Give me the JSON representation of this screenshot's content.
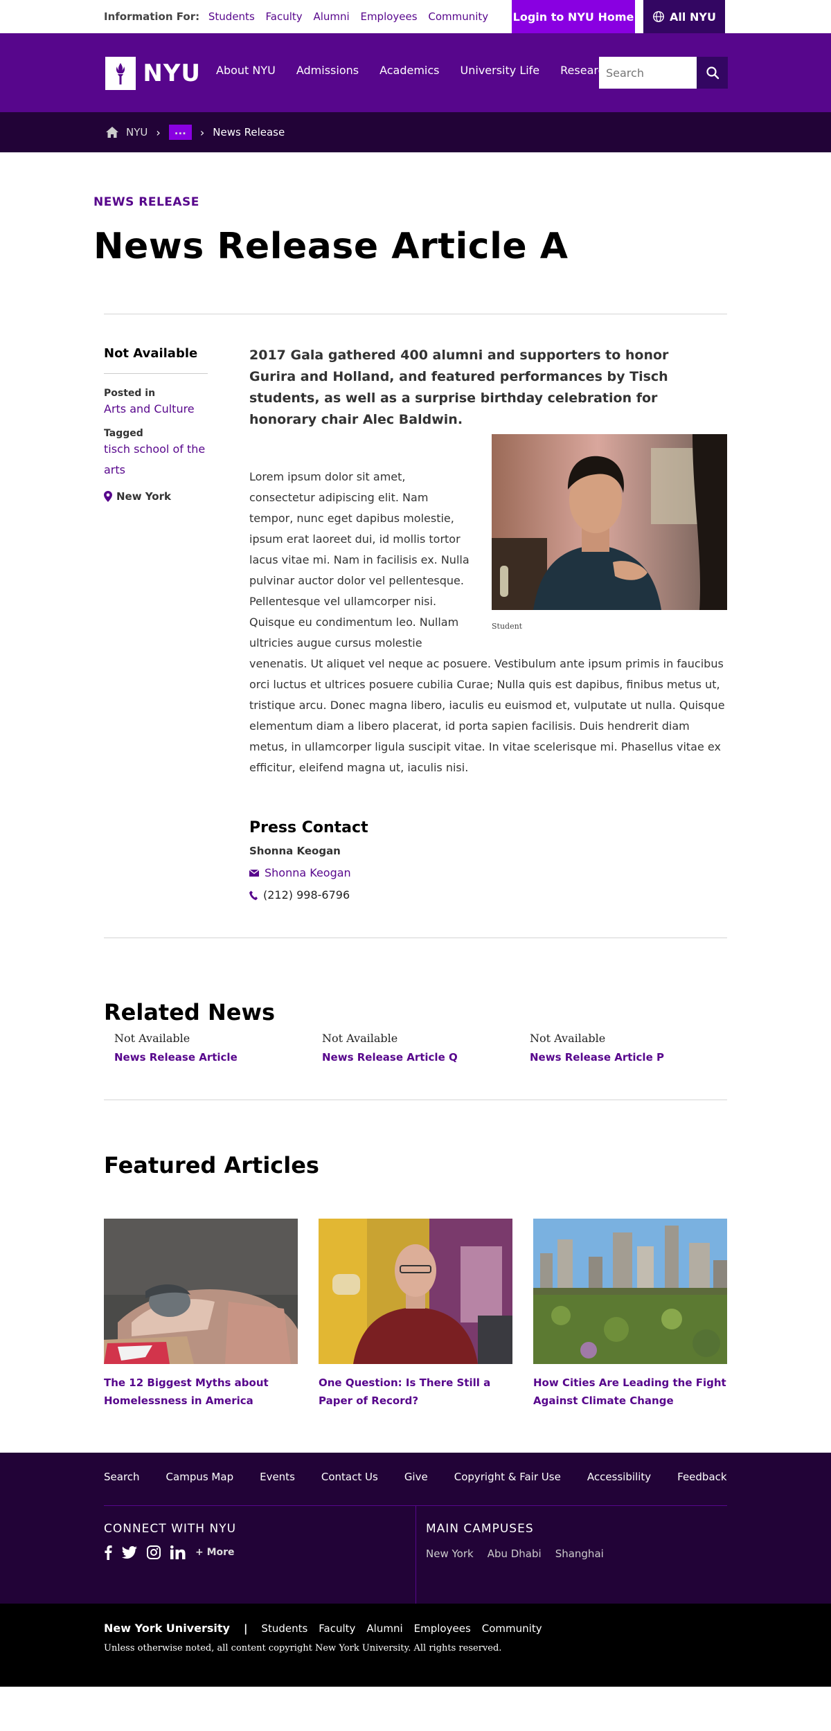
{
  "utility": {
    "info_label": "Information For:",
    "audiences": [
      "Students",
      "Faculty",
      "Alumni",
      "Employees",
      "Community"
    ],
    "login_label": "Login to NYU Home",
    "all_nyu_label": "All NYU"
  },
  "header": {
    "logo_text": "NYU",
    "nav": [
      "About NYU",
      "Admissions",
      "Academics",
      "University Life",
      "Research"
    ],
    "search_placeholder": "Search"
  },
  "breadcrumb": {
    "home": "NYU",
    "ellipsis": "...",
    "current": "News Release"
  },
  "article": {
    "kicker": "NEWS RELEASE",
    "title": "News Release Article A",
    "lead": "2017 Gala gathered 400 alumni and supporters to honor Gurira and Holland, and featured performances by Tisch students, as well as a surprise birthday celebration for honorary chair Alec Baldwin.",
    "image_caption": "Student",
    "body": "Lorem ipsum dolor sit amet, consectetur adipiscing elit. Nam tempor, nunc eget dapibus molestie, ipsum erat laoreet dui, id mollis tortor lacus vitae mi. Nam in facilisis ex. Nulla pulvinar auctor dolor vel pellentesque. Pellentesque vel ullamcorper nisi. Quisque eu condimentum leo. Nullam ultricies augue cursus molestie venenatis. Ut aliquet vel neque ac posuere. Vestibulum ante ipsum primis in faucibus orci luctus et ultrices posuere cubilia Curae; Nulla quis est dapibus, finibus metus ut, tristique arcu. Donec magna libero, iaculis eu euismod et, vulputate ut nulla. Quisque elementum diam a libero placerat, id porta sapien facilisis. Duis hendrerit diam metus, in ullamcorper ligula suscipit vitae. In vitae scelerisque mi. Phasellus vitae ex efficitur, eleifend magna ut, iaculis nisi."
  },
  "sidebar": {
    "status": "Not Available",
    "posted_label": "Posted in",
    "posted_value": "Arts and Culture",
    "tagged_label": "Tagged",
    "tagged_value": "tisch school of the arts",
    "location": "New York"
  },
  "press": {
    "heading": "Press Contact",
    "name": "Shonna Keogan",
    "email_link": "Shonna Keogan",
    "phone": "(212) 998-6796"
  },
  "related": {
    "heading": "Related News",
    "items": [
      {
        "status": "Not Available",
        "title": "News Release Article"
      },
      {
        "status": "Not Available",
        "title": "News Release Article Q"
      },
      {
        "status": "Not Available",
        "title": "News Release Article P"
      }
    ]
  },
  "featured": {
    "heading": "Featured Articles",
    "items": [
      {
        "title": "The 12 Biggest Myths about Homelessness in America"
      },
      {
        "title": "One Question: Is There Still a Paper of Record?"
      },
      {
        "title": "How Cities Are Leading the Fight Against Climate Change"
      }
    ]
  },
  "footer": {
    "links": [
      "Search",
      "Campus Map",
      "Events",
      "Contact Us",
      "Give",
      "Copyright & Fair Use",
      "Accessibility",
      "Feedback"
    ],
    "connect_heading": "CONNECT WITH NYU",
    "more_label": "+ More",
    "campus_heading": "MAIN CAMPUSES",
    "campuses": [
      "New York",
      "Abu Dhabi",
      "Shanghai"
    ],
    "university": "New York University",
    "separator": "|",
    "bottom_links": [
      "Students",
      "Faculty",
      "Alumni",
      "Employees",
      "Community"
    ],
    "copyright": "Unless otherwise noted, all content copyright New York University. All rights reserved."
  },
  "colors": {
    "brand_purple": "#57068c",
    "bright_purple": "#8900e1",
    "dark_purple": "#330662",
    "deep_purple": "#220337"
  }
}
